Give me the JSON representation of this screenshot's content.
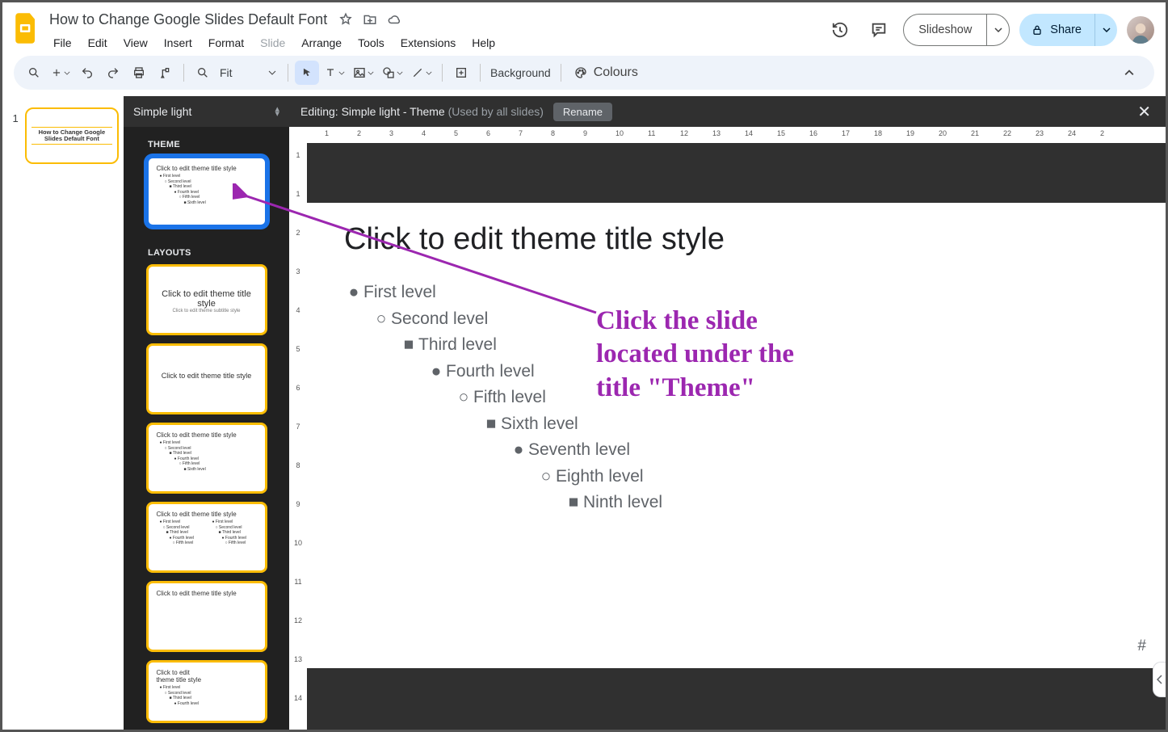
{
  "header": {
    "doc_title": "How to Change Google Slides Default Font",
    "menus": [
      "File",
      "Edit",
      "View",
      "Insert",
      "Format",
      "Slide",
      "Arrange",
      "Tools",
      "Extensions",
      "Help"
    ],
    "disabled_menu": "Slide",
    "slideshow_label": "Slideshow",
    "share_label": "Share"
  },
  "toolbar": {
    "zoom_value": "Fit",
    "background_label": "Background",
    "colours_label": "Colours"
  },
  "filmstrip": {
    "slide_number": "1",
    "mini_title": "How to Change Google Slides Default Font"
  },
  "theme_panel": {
    "picker_label": "Simple light",
    "section_theme": "THEME",
    "section_layouts": "LAYOUTS",
    "theme_thumb_title": "Click to edit theme title style",
    "layout1_title": "Click to edit theme title style",
    "layout1_sub": "Click to edit theme subtitle style",
    "layout2_title": "Click to edit theme title style",
    "layout3_title": "Click to edit theme title style",
    "layout4_title": "Click to edit theme title style",
    "layout5_title": "Click to edit theme title style",
    "layout6_title": "Click to edit theme title style",
    "levels": [
      "● First level",
      "○ Second level",
      "■ Third level",
      "● Fourth level",
      "○ Fifth level",
      "■ Sixth level"
    ]
  },
  "editor": {
    "head_prefix": "Editing: ",
    "head_theme": "Simple light - Theme",
    "head_used": "(Used by all slides)",
    "rename": "Rename",
    "canvas_title": "Click to edit theme title style",
    "lv1": "First level",
    "lv2": "Second level",
    "lv3": "Third level",
    "lv4": "Fourth level",
    "lv5": "Fifth level",
    "lv6": "Sixth level",
    "lv7": "Seventh level",
    "lv8": "Eighth level",
    "lv9": "Ninth level",
    "hash": "#"
  },
  "ruler": {
    "h": [
      "1",
      "2",
      "3",
      "4",
      "5",
      "6",
      "7",
      "8",
      "9",
      "10",
      "11",
      "12",
      "13",
      "14",
      "15",
      "16",
      "17",
      "18",
      "19",
      "20",
      "21",
      "22",
      "23",
      "24",
      "2"
    ],
    "v": [
      "1",
      "1",
      "2",
      "3",
      "4",
      "5",
      "6",
      "7",
      "8",
      "9",
      "10",
      "11",
      "12",
      "13",
      "14"
    ]
  },
  "annotation": {
    "line1": "Click the slide",
    "line2": "located under the",
    "line3": "title \"Theme\""
  }
}
